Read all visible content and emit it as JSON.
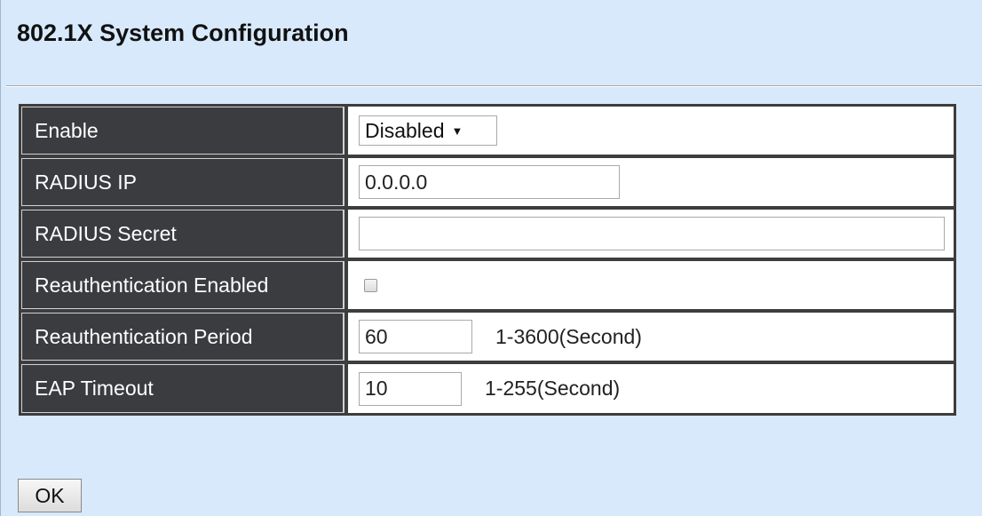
{
  "page": {
    "title": "802.1X System Configuration"
  },
  "form": {
    "enable": {
      "label": "Enable",
      "selected": "Disabled"
    },
    "radius_ip": {
      "label": "RADIUS IP",
      "value": "0.0.0.0"
    },
    "radius_secret": {
      "label": "RADIUS Secret",
      "value": ""
    },
    "reauth_enabled": {
      "label": "Reauthentication Enabled",
      "checked": false
    },
    "reauth_period": {
      "label": "Reauthentication Period",
      "value": "60",
      "range": "1-3600(Second)"
    },
    "eap_timeout": {
      "label": "EAP Timeout",
      "value": "10",
      "range": "1-255(Second)"
    }
  },
  "actions": {
    "ok_label": "OK"
  }
}
